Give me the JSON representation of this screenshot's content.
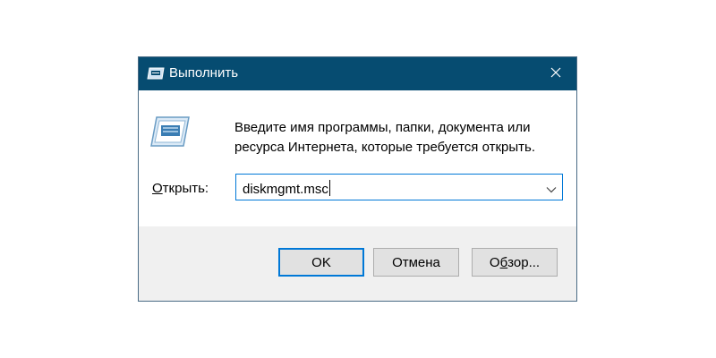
{
  "window": {
    "title": "Выполнить",
    "accent_color": "#064c71",
    "focus_color": "#0078d7"
  },
  "content": {
    "description": "Введите имя программы, папки, документа или ресурса Интернета, которые требуется открыть.",
    "open_label_mnemonic": "О",
    "open_label_rest": "ткрыть:",
    "input_value": "diskmgmt.msc"
  },
  "buttons": {
    "ok": "OK",
    "cancel": "Отмена",
    "browse_mnemonic": "б",
    "browse_prefix": "О",
    "browse_rest": "зор..."
  },
  "icons": {
    "title": "run-icon",
    "main": "run-icon",
    "close": "close-icon",
    "dropdown": "chevron-down-icon"
  }
}
